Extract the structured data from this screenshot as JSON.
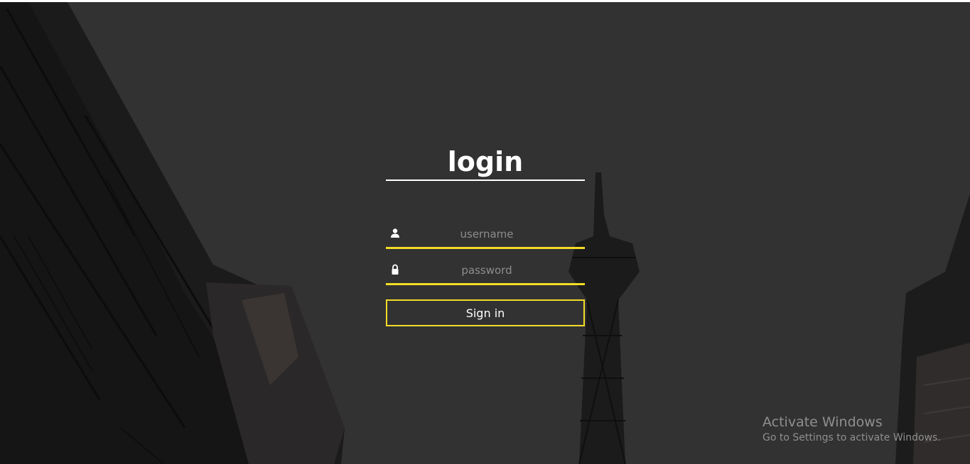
{
  "login": {
    "title": "login",
    "username_placeholder": "username",
    "password_placeholder": "password",
    "signin_label": "Sign in"
  },
  "icons": {
    "username": "user-icon",
    "password": "lock-icon"
  },
  "colors": {
    "accent": "#f2dd26",
    "background": "#333233",
    "text": "#ffffff",
    "placeholder": "#8d8d8d"
  },
  "watermark": {
    "title": "Activate Windows",
    "subtitle": "Go to Settings to activate Windows."
  }
}
